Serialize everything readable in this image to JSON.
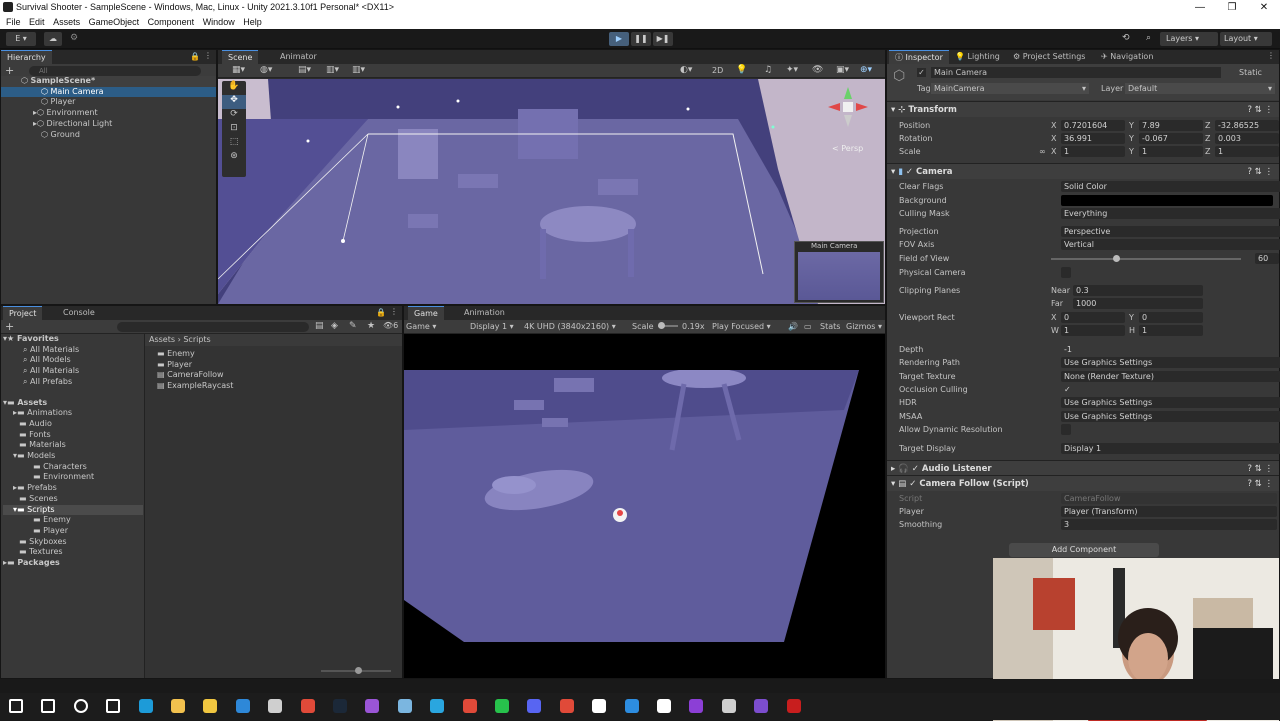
{
  "window": {
    "title": "Survival Shooter - SampleScene - Windows, Mac, Linux - Unity 2021.3.10f1 Personal* <DX11>",
    "controls": [
      "—",
      "❐",
      "✕"
    ]
  },
  "menu": [
    "File",
    "Edit",
    "Assets",
    "GameObject",
    "Component",
    "Window",
    "Help"
  ],
  "toolbar": {
    "account": "E ▾",
    "layers_label": "Layers",
    "layout_label": "Layout"
  },
  "hierarchy": {
    "tab": "Hierarchy",
    "search_placeholder": "All",
    "scene": "SampleScene*",
    "items": [
      "Main Camera",
      "Player",
      "Environment",
      "Directional Light",
      "Ground"
    ]
  },
  "scene_view": {
    "tabs": [
      "Scene",
      "Animator"
    ],
    "mode_2d": "2D",
    "persp_label": "Persp",
    "camera_preview_label": "Main Camera"
  },
  "project": {
    "tabs": [
      "Project",
      "Console"
    ],
    "favorites_label": "Favorites",
    "favorites": [
      "All Materials",
      "All Models",
      "All Materials",
      "All Prefabs"
    ],
    "assets_label": "Assets",
    "asset_tree": [
      "Animations",
      "Audio",
      "Fonts",
      "Materials",
      "Models",
      "Characters",
      "Environment",
      "Prefabs",
      "Scenes",
      "Scripts",
      "Enemy",
      "Player",
      "Skyboxes",
      "Textures"
    ],
    "packages_label": "Packages",
    "breadcrumb": [
      "Assets",
      "Scripts"
    ],
    "files": [
      "Enemy",
      "Player",
      "CameraFollow",
      "ExampleRaycast"
    ],
    "count_badge": "6"
  },
  "game_view": {
    "tabs": [
      "Game",
      "Animation"
    ],
    "view_select": "Game",
    "display": "Display 1",
    "resolution": "4K UHD (3840x2160)",
    "scale_label": "Scale",
    "scale_value": "0.19x",
    "focus": "Play Focused",
    "stats": "Stats",
    "gizmos": "Gizmos"
  },
  "inspector": {
    "tabs": [
      "Inspector",
      "Lighting",
      "Project Settings",
      "Navigation"
    ],
    "object_name": "Main Camera",
    "static_label": "Static",
    "tag_label": "Tag",
    "tag_value": "MainCamera",
    "layer_label": "Layer",
    "layer_value": "Default",
    "transform": {
      "title": "Transform",
      "position": {
        "label": "Position",
        "x": "0.7201604",
        "y": "7.89",
        "z": "-32.86525"
      },
      "rotation": {
        "label": "Rotation",
        "x": "36.991",
        "y": "-0.067",
        "z": "0.003"
      },
      "scale": {
        "label": "Scale",
        "x": "1",
        "y": "1",
        "z": "1"
      }
    },
    "camera": {
      "title": "Camera",
      "rows": [
        {
          "label": "Clear Flags",
          "value": "Solid Color"
        },
        {
          "label": "Background",
          "value": ""
        },
        {
          "label": "Culling Mask",
          "value": "Everything"
        },
        {
          "label": "Projection",
          "value": "Perspective"
        },
        {
          "label": "FOV Axis",
          "value": "Vertical"
        },
        {
          "label": "Field of View",
          "value": "60"
        },
        {
          "label": "Physical Camera",
          "value": ""
        },
        {
          "label": "Clipping Planes",
          "value": ""
        },
        {
          "label": "Viewport Rect",
          "value": ""
        },
        {
          "label": "Depth",
          "value": "-1"
        },
        {
          "label": "Rendering Path",
          "value": "Use Graphics Settings"
        },
        {
          "label": "Target Texture",
          "value": "None (Render Texture)"
        },
        {
          "label": "Occlusion Culling",
          "value": "✓"
        },
        {
          "label": "HDR",
          "value": "Use Graphics Settings"
        },
        {
          "label": "MSAA",
          "value": "Use Graphics Settings"
        },
        {
          "label": "Allow Dynamic Resolution",
          "value": ""
        },
        {
          "label": "Target Display",
          "value": "Display 1"
        }
      ],
      "near_label": "Near",
      "near": "0.3",
      "far_label": "Far",
      "far": "1000",
      "vp_x": "0",
      "vp_y": "0",
      "vp_w": "1",
      "vp_h": "1"
    },
    "audio_listener": "Audio Listener",
    "camera_follow": {
      "title": "Camera Follow (Script)",
      "script_label": "Script",
      "script_value": "CameraFollow",
      "player_label": "Player",
      "player_value": "Player (Transform)",
      "smoothing_label": "Smoothing",
      "smoothing_value": "3"
    },
    "add_component": "Add Component"
  },
  "taskbar": {
    "icons": [
      "windows-start",
      "search",
      "cortana",
      "task-view",
      "edge",
      "store",
      "explorer",
      "mail",
      "unity-hub",
      "chrome",
      "steam",
      "app-a",
      "app-b",
      "telegram",
      "chrome-2",
      "whatsapp",
      "discord",
      "chrome-3",
      "notion",
      "vscode",
      "github",
      "app-c",
      "unity",
      "visual-studio",
      "filezilla"
    ],
    "colors": [
      "#ffffff",
      "#ffffff",
      "#ffffff",
      "#ffffff",
      "#1d9bd8",
      "#f2c14e",
      "#f0c640",
      "#2e88d8",
      "#cfcfcf",
      "#e04a39",
      "#1b2838",
      "#9a55d6",
      "#7bb6e0",
      "#2aa6df",
      "#e04a39",
      "#27c24c",
      "#5865f2",
      "#e04a39",
      "#ffffff",
      "#2d8de0",
      "#ffffff",
      "#8c3fd6",
      "#cfcfcf",
      "#7c4dce",
      "#c81e1e"
    ]
  },
  "colors": {
    "accent": "#4a8fe0",
    "scene_purple": "#4b4690"
  }
}
